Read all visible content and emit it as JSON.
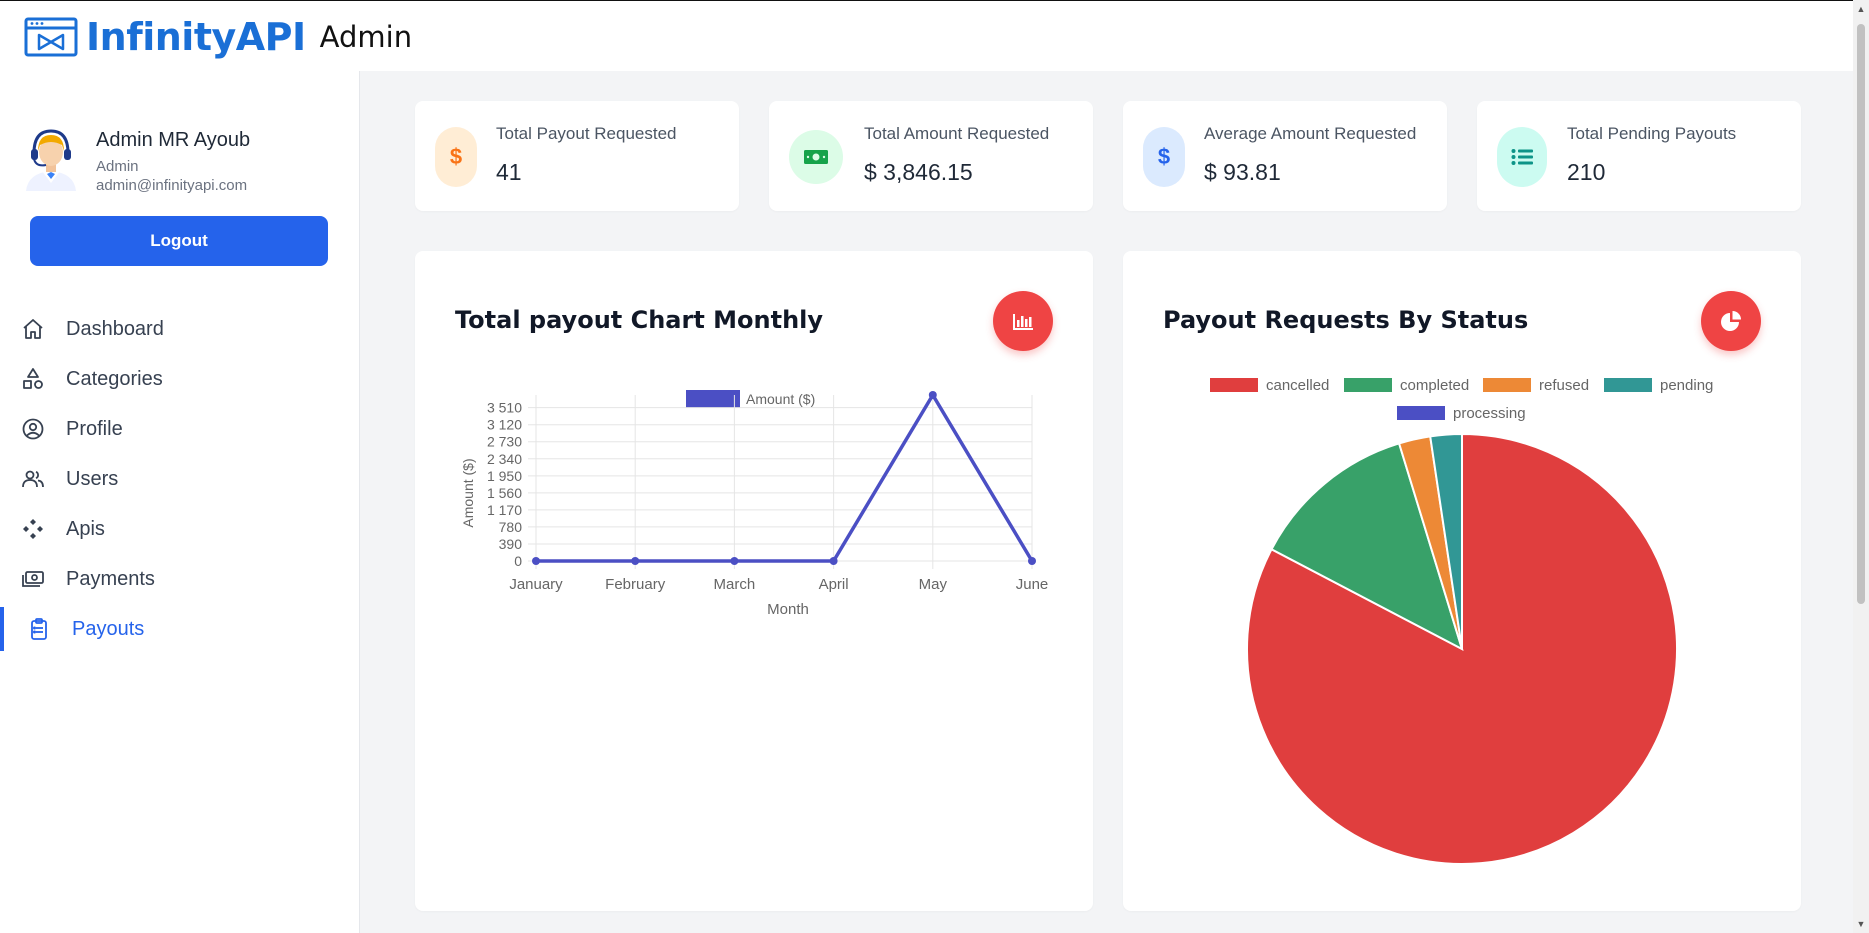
{
  "brand": {
    "name": "InfinityAPI",
    "subtitle": "Admin"
  },
  "user": {
    "name": "Admin MR Ayoub",
    "role": "Admin",
    "email": "admin@infinityapi.com",
    "logout_label": "Logout"
  },
  "nav": {
    "items": [
      {
        "label": "Dashboard",
        "icon": "home-icon"
      },
      {
        "label": "Categories",
        "icon": "shapes-icon"
      },
      {
        "label": "Profile",
        "icon": "user-circle-icon"
      },
      {
        "label": "Users",
        "icon": "users-icon"
      },
      {
        "label": "Apis",
        "icon": "apis-icon"
      },
      {
        "label": "Payments",
        "icon": "cash-icon"
      },
      {
        "label": "Payouts",
        "icon": "clipboard-icon",
        "active": true
      }
    ]
  },
  "stats": [
    {
      "label": "Total Payout Requested",
      "value": "41",
      "icon": "dollar-icon",
      "icon_color": "#f97316",
      "icon_bg": "#ffedd5"
    },
    {
      "label": "Total Amount Requested",
      "value": "$ 3,846.15",
      "icon": "cash-icon",
      "icon_color": "#16a34a",
      "icon_bg": "#dcfce7"
    },
    {
      "label": "Average Amount Requested",
      "value": "$ 93.81",
      "icon": "dollar-icon",
      "icon_color": "#2563eb",
      "icon_bg": "#dbeafe"
    },
    {
      "label": "Total Pending Payouts",
      "value": "210",
      "icon": "list-icon",
      "icon_color": "#0d9488",
      "icon_bg": "#ccfbf1"
    }
  ],
  "charts": {
    "line_title": "Total payout Chart Monthly",
    "pie_title": "Payout Requests By Status"
  },
  "chart_data": [
    {
      "type": "line",
      "title": "Total payout Chart Monthly",
      "xlabel": "Month",
      "ylabel": "Amount ($)",
      "categories": [
        "January",
        "February",
        "March",
        "April",
        "May",
        "June"
      ],
      "series": [
        {
          "name": "Amount ($)",
          "values": [
            0,
            0,
            0,
            0,
            3800,
            0
          ],
          "color": "#4b4fc4"
        }
      ],
      "yticks": [
        0,
        390,
        780,
        1170,
        1560,
        1950,
        2340,
        2730,
        3120,
        3510
      ],
      "ytick_labels": [
        "0",
        "390",
        "780",
        "1 170",
        "1 560",
        "1 950",
        "2 340",
        "2 730",
        "3 120",
        "3 510"
      ],
      "ylim": [
        0,
        3800
      ],
      "grid": true,
      "legend": "top"
    },
    {
      "type": "pie",
      "title": "Payout Requests By Status",
      "labels": [
        "cancelled",
        "completed",
        "refused",
        "pending",
        "processing"
      ],
      "values": [
        210,
        32,
        6,
        6,
        0
      ],
      "colors": [
        "#e03e3e",
        "#38a169",
        "#ed8936",
        "#319795",
        "#4b4fc4"
      ],
      "legend": "top"
    }
  ]
}
